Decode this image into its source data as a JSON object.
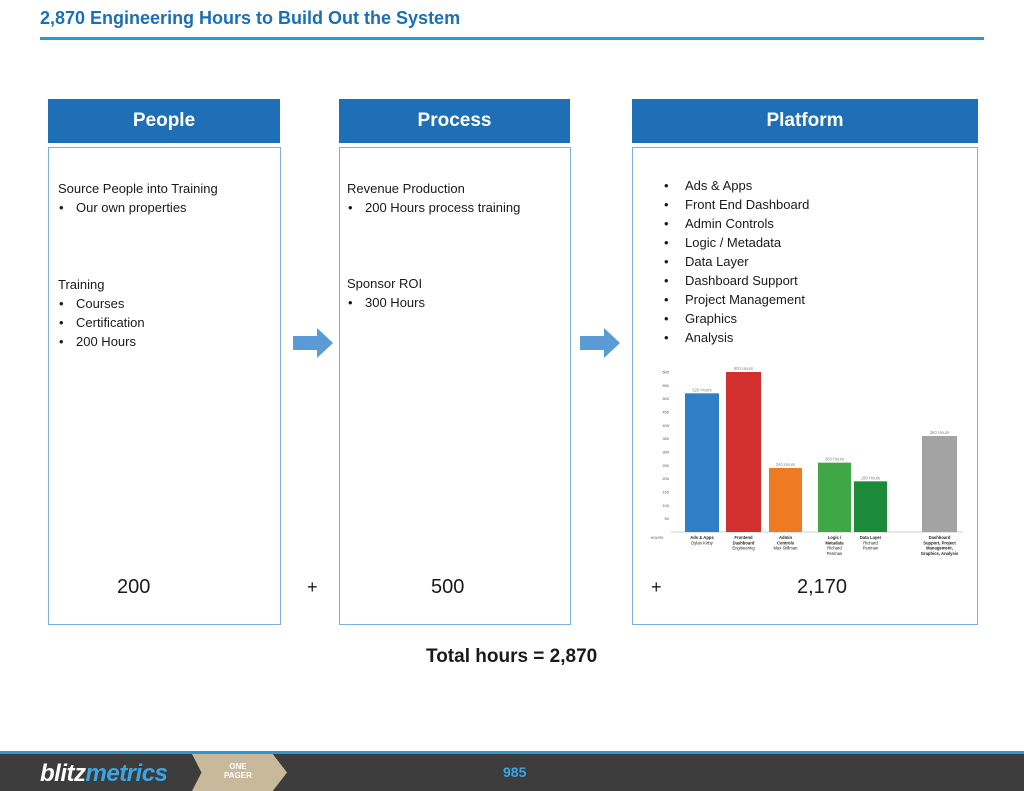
{
  "title": "2,870 Engineering Hours to Build Out the System",
  "columns": {
    "people": {
      "header": "People",
      "section1_title": "Source People into Training",
      "section1_items": [
        "Our own properties"
      ],
      "section2_title": "Training",
      "section2_items": [
        "Courses",
        "Certification",
        "200 Hours"
      ],
      "total": "200"
    },
    "process": {
      "header": "Process",
      "section1_title": "Revenue Production",
      "section1_items": [
        "200 Hours process training"
      ],
      "section2_title": "Sponsor ROI",
      "section2_items": [
        "300 Hours"
      ],
      "total": "500"
    },
    "platform": {
      "header": "Platform",
      "items": [
        "Ads & Apps",
        "Front End Dashboard",
        "Admin Controls",
        "Logic / Metadata",
        "Data Layer",
        "Dashboard Support",
        "Project Management",
        "Graphics",
        "Analysis"
      ],
      "total": "2,170"
    }
  },
  "plus_sign": "+",
  "total_hours": "Total hours = 2,870",
  "footer": {
    "logo_part1": "blitz",
    "logo_part2": "metrics",
    "badge_line1": "ONE",
    "badge_line2": "PAGER",
    "page_number": "985"
  },
  "colors": {
    "header_blue": "#1f6fb6",
    "rule_blue": "#2a98d4",
    "arrow_blue": "#5b9bd5",
    "footer_dark": "#3c3c3c",
    "badge_tan": "#c8b99a"
  },
  "chart_data": {
    "type": "bar",
    "ylabel": "HOURS",
    "ylim": [
      0,
      600
    ],
    "yticks": [
      50,
      100,
      150,
      200,
      250,
      300,
      350,
      400,
      450,
      500,
      550,
      600
    ],
    "categories": [
      {
        "line1": "Ads & Apps",
        "line2": "Dylan Kirby"
      },
      {
        "line1": "Frontend",
        "line2": "Dashboard",
        "line3": "Engineering"
      },
      {
        "line1": "Admin",
        "line2": "Controls",
        "line3": "Max Stillman"
      },
      {
        "line1": "Logic /",
        "line2": "Metadata",
        "line3": "Richard",
        "line4": "Penman"
      },
      {
        "line1": "Data Layer",
        "line2": "Richard",
        "line3": "Penman"
      },
      {
        "line1": "Dashboard",
        "line2": "Support, Project",
        "line3": "Management,",
        "line4": "Graphics, Analysis"
      }
    ],
    "values": [
      520,
      600,
      240,
      260,
      190,
      360
    ],
    "bar_labels": [
      "520 Hours",
      "600 Hours",
      "240 Hours",
      "260 Hours",
      "190 Hours",
      "360 Hours"
    ],
    "colors": [
      "#2e7fc5",
      "#d22f2f",
      "#ee7a22",
      "#3fa746",
      "#1d8a3a",
      "#a3a3a3"
    ]
  }
}
